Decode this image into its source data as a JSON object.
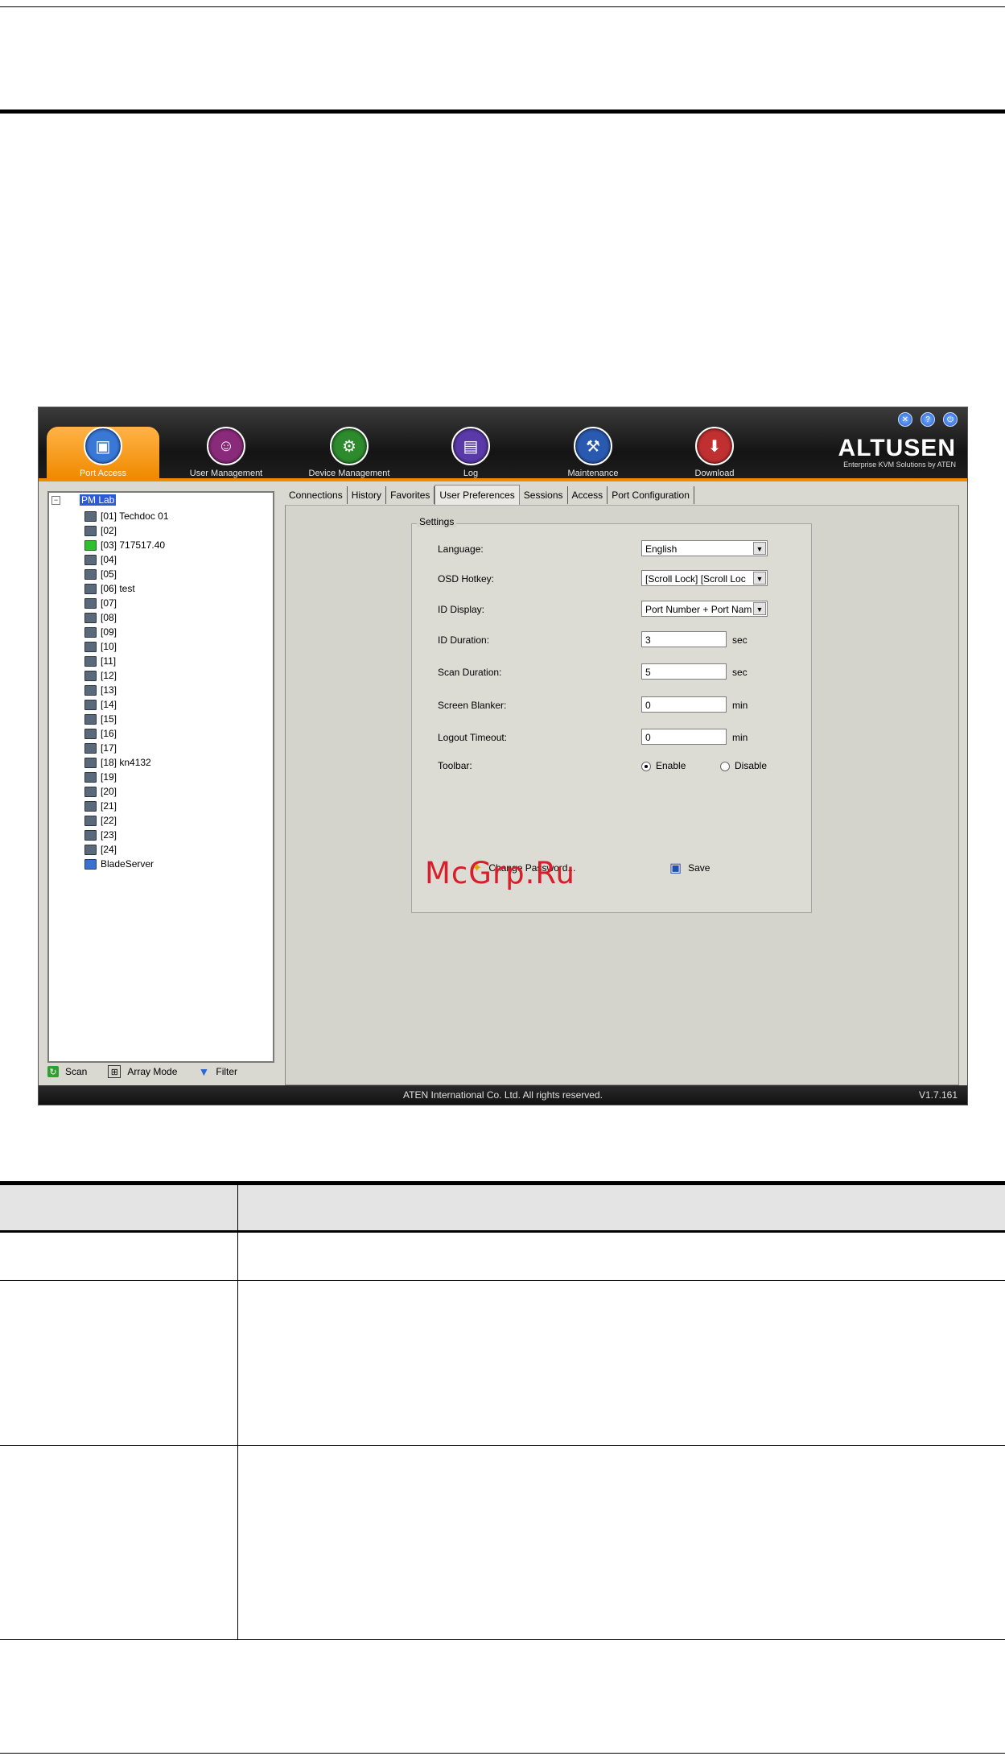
{
  "app": {
    "window_buttons": [
      "✕",
      "?",
      "⏻"
    ],
    "brand": {
      "name": "ALTUSEN",
      "tagline": "Enterprise KVM Solutions by ATEN"
    },
    "toolbar": [
      {
        "label": "Port Access",
        "icon": "▣",
        "color": "#3a78d8",
        "active": true
      },
      {
        "label": "User Management",
        "icon": "☺",
        "color": "#8a2a7a",
        "active": false
      },
      {
        "label": "Device Management",
        "icon": "⚙",
        "color": "#2d8a2d",
        "active": false
      },
      {
        "label": "Log",
        "icon": "▤",
        "color": "#5a3aa8",
        "active": false
      },
      {
        "label": "Maintenance",
        "icon": "⚒",
        "color": "#2a5ab0",
        "active": false
      },
      {
        "label": "Download",
        "icon": "⬇",
        "color": "#c03030",
        "active": false
      }
    ],
    "tree": {
      "expander": "−",
      "root": "PM Lab",
      "items": [
        {
          "label": "[01] Techdoc 01",
          "state": "off"
        },
        {
          "label": "[02]",
          "state": "off"
        },
        {
          "label": "[03] 717517.40",
          "state": "on"
        },
        {
          "label": "[04]",
          "state": "off"
        },
        {
          "label": "[05]",
          "state": "off"
        },
        {
          "label": "[06] test",
          "state": "off"
        },
        {
          "label": "[07]",
          "state": "off"
        },
        {
          "label": "[08]",
          "state": "off"
        },
        {
          "label": "[09]",
          "state": "off"
        },
        {
          "label": "[10]",
          "state": "off"
        },
        {
          "label": "[11]",
          "state": "off"
        },
        {
          "label": "[12]",
          "state": "off"
        },
        {
          "label": "[13]",
          "state": "off"
        },
        {
          "label": "[14]",
          "state": "off"
        },
        {
          "label": "[15]",
          "state": "off"
        },
        {
          "label": "[16]",
          "state": "off"
        },
        {
          "label": "[17]",
          "state": "off"
        },
        {
          "label": "[18] kn4132",
          "state": "off"
        },
        {
          "label": "[19]",
          "state": "off"
        },
        {
          "label": "[20]",
          "state": "off"
        },
        {
          "label": "[21]",
          "state": "off"
        },
        {
          "label": "[22]",
          "state": "off"
        },
        {
          "label": "[23]",
          "state": "off"
        },
        {
          "label": "[24]",
          "state": "off"
        },
        {
          "label": "BladeServer",
          "state": "blade"
        }
      ]
    },
    "bottom": {
      "scan": "Scan",
      "array_mode": "Array Mode",
      "filter": "Filter"
    },
    "tabs": [
      "Connections",
      "History",
      "Favorites",
      "User Preferences",
      "Sessions",
      "Access",
      "Port Configuration"
    ],
    "active_tab": "User Preferences",
    "settings": {
      "legend": "Settings",
      "language": {
        "label": "Language:",
        "value": "English"
      },
      "osd_hotkey": {
        "label": "OSD Hotkey:",
        "value": "[Scroll Lock] [Scroll Loc"
      },
      "id_display": {
        "label": "ID Display:",
        "value": "Port Number + Port Nam"
      },
      "id_duration": {
        "label": "ID Duration:",
        "value": "3",
        "unit": "sec"
      },
      "scan_duration": {
        "label": "Scan Duration:",
        "value": "5",
        "unit": "sec"
      },
      "screen_blanker": {
        "label": "Screen Blanker:",
        "value": "0",
        "unit": "min"
      },
      "logout_timeout": {
        "label": "Logout Timeout:",
        "value": "0",
        "unit": "min"
      },
      "toolbar": {
        "label": "Toolbar:",
        "enable": "Enable",
        "disable": "Disable",
        "selected": "Enable"
      },
      "change_password": "Change Password...",
      "save": "Save"
    },
    "status": {
      "copyright": "ATEN International Co. Ltd. All rights reserved.",
      "version": "V1.7.161"
    }
  },
  "watermark": "McGrp.Ru"
}
